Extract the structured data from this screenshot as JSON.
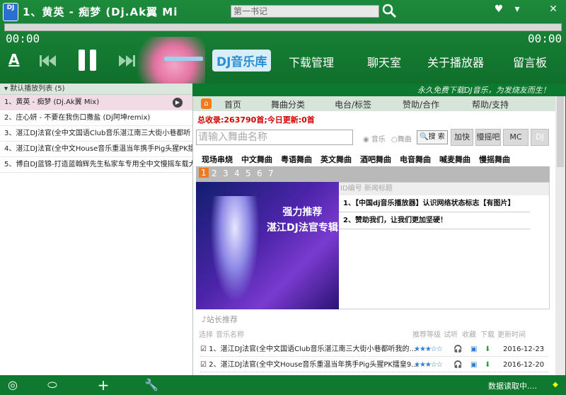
{
  "app": {
    "logo": "DJ",
    "song_title": "1、黄英 - 痴梦 (Dj.Ak翼 Mi",
    "search_placeholder": "第一书记"
  },
  "window": {
    "skin": "♥",
    "menu": "▾",
    "close": "✕"
  },
  "player": {
    "time_current": "00:00",
    "time_total": "00:00",
    "progress": 0,
    "text_icon": "A"
  },
  "main_tabs": [
    "DJ音乐库",
    "下载管理",
    "聊天室",
    "关于播放器",
    "留言板"
  ],
  "playlist": {
    "header": "默认播放列表 (5)",
    "items": [
      "1、黄英 - 痴梦 (Dj.Ak翼 Mix)",
      "2、庄心妍 - 不要在我伤口撒盐 (Dj阿坤remix)",
      "3、湛江DJ法官(全中文国语Club音乐湛江南三大街小巷都听",
      "4、湛江DJ法官(全中文House音乐重温当年携手Pig头猩PK擂",
      "5、博白DJ蓝锦-打造蓝翰辉先生私家车专用全中文慢摇车载大"
    ]
  },
  "slogan": "永久免费下载DJ音乐，为发烧友而生！",
  "site": {
    "tabs": [
      "首页",
      "舞曲分类",
      "电台/标签",
      "赞助/合作",
      "帮助/支持"
    ],
    "stat": "总收录:263790首;今日更新:0首",
    "search_placeholder": "请输入舞曲名称",
    "radio_music": "音乐",
    "radio_dance": "舞曲",
    "search_button": "搜 索",
    "buttons": [
      "加快",
      "慢摇吧",
      "MC",
      "DJ"
    ],
    "categories": [
      "现场串烧",
      "中文舞曲",
      "粤语舞曲",
      "英文舞曲",
      "酒吧舞曲",
      "电音舞曲",
      "喊麦舞曲",
      "慢摇舞曲"
    ],
    "pages": [
      "1",
      "2",
      "3",
      "4",
      "5",
      "6",
      "7"
    ],
    "banner_line1": "强力推荐",
    "banner_line2": "湛江DJ法官专辑",
    "news_head": "ID编号  新闻标题",
    "news": [
      "1、【中国dj音乐播放器】认识网络状态标志【有图片】",
      "2、赞助我们，让我们更加坚硬！"
    ],
    "rec_head": "站长推荐",
    "col_heads": [
      "选择",
      "音乐名称",
      "推荐等级",
      "试听",
      "收藏",
      "下载",
      "更新时间"
    ],
    "rec_rows": [
      {
        "name": "1、湛江DJ法官(全中文国语Club音乐湛江南三大街小巷都听我的...",
        "stars": "★★★☆☆",
        "date": "2016-12-23"
      },
      {
        "name": "2、湛江DJ法官(全中文House音乐重温当年携手Pig头猩PK擂皇9...",
        "stars": "★★★☆☆",
        "date": "2016-12-20"
      }
    ]
  },
  "bottom": {
    "status": "数据读取中...."
  }
}
